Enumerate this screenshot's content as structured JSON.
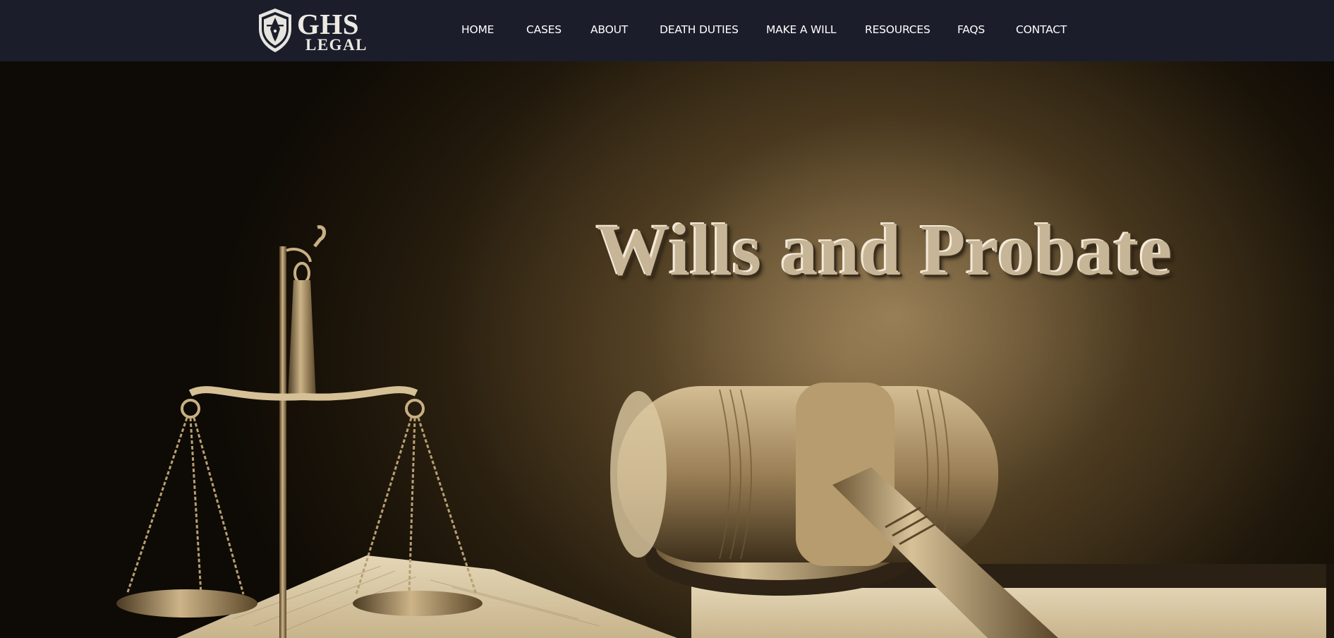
{
  "brand": {
    "logo_main": "GHS",
    "logo_sub": "LEGAL",
    "logo_icon": "shield-pen-icon"
  },
  "nav": {
    "items": [
      {
        "label": "HOME"
      },
      {
        "label": "CASES"
      },
      {
        "label": "ABOUT"
      },
      {
        "label": "DEATH DUTIES"
      },
      {
        "label": "MAKE A WILL"
      },
      {
        "label": "RESOURCES"
      },
      {
        "label": "FAQS"
      },
      {
        "label": "CONTACT"
      }
    ]
  },
  "hero": {
    "title": "Wills and Probate"
  },
  "colors": {
    "header_bg": "#1b1d2a",
    "nav_text": "#ffffff",
    "title_color": "#c7b597"
  }
}
